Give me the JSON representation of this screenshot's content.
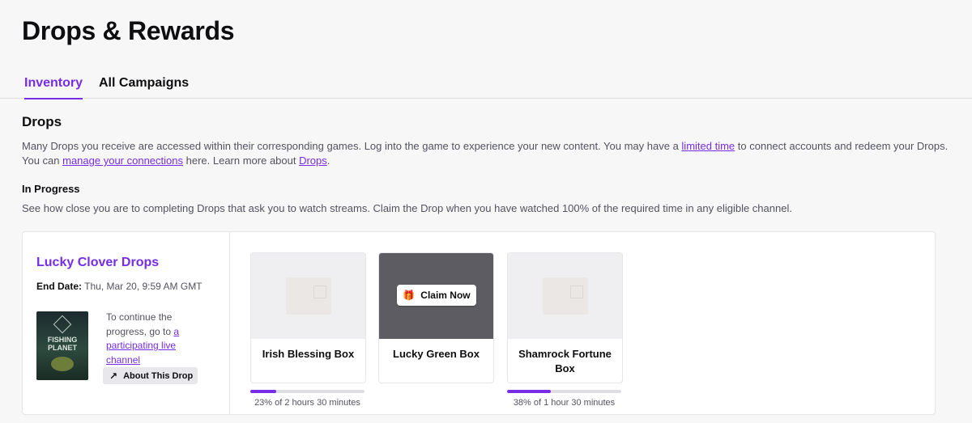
{
  "header": {
    "title": "Drops & Rewards"
  },
  "tabs": [
    {
      "label": "Inventory",
      "active": true
    },
    {
      "label": "All Campaigns",
      "active": false
    }
  ],
  "drops_section": {
    "title": "Drops",
    "desc_part1": "Many Drops you receive are accessed within their corresponding games. Log into the game to experience your new content. You may have a ",
    "link_limited_time": "limited time",
    "desc_part2": " to connect accounts and redeem your Drops. You can ",
    "link_manage_connections": "manage your connections",
    "desc_part3": " here. Learn more about ",
    "link_drops": "Drops",
    "desc_part4": "."
  },
  "in_progress": {
    "title": "In Progress",
    "description": "See how close you are to completing Drops that ask you to watch streams. Claim the Drop when you have watched 100% of the required time in any eligible channel."
  },
  "campaign": {
    "name": "Lucky Clover Drops",
    "end_date_label": "End Date:",
    "end_date_value": " Thu, Mar 20, 9:59 AM GMT",
    "cover_title": "FISHING PLANET",
    "continue_text": "To continue the progress, go to ",
    "continue_link": "a participating live channel",
    "about_button": "About This Drop",
    "icons": {
      "about": "arrow-up-right-icon",
      "claim": "gift-icon"
    },
    "accent_color": "#772ce8"
  },
  "drops": [
    {
      "name": "Irish Blessing Box",
      "progress_fraction": 0.23,
      "progress_text": "23% of 2 hours 30 minutes",
      "claimable": false
    },
    {
      "name": "Lucky Green Box",
      "claim_label": "Claim Now",
      "claimable": true
    },
    {
      "name": "Shamrock Fortune Box",
      "progress_fraction": 0.38,
      "progress_text": "38% of 1 hour 30 minutes",
      "claimable": false
    }
  ]
}
